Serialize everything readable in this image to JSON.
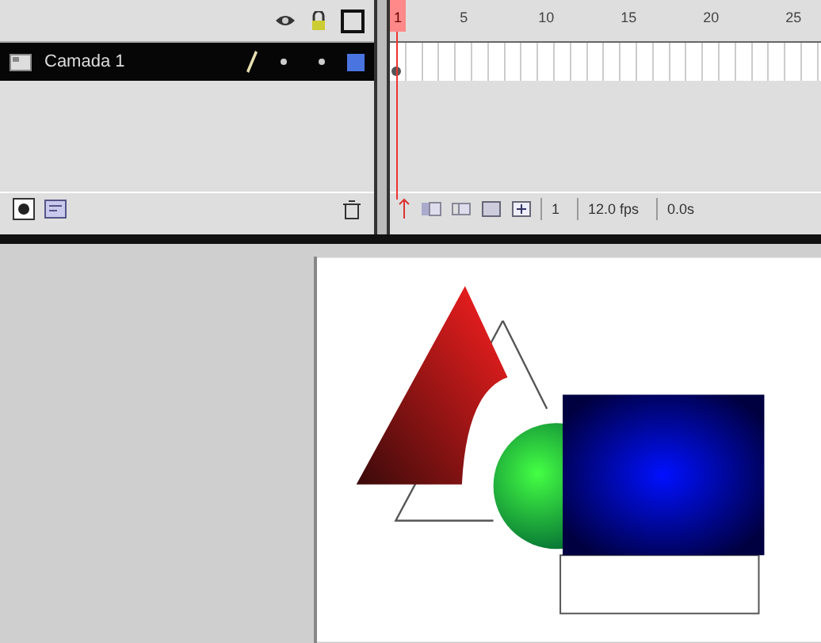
{
  "frame_ruler": [
    {
      "label": "1",
      "selected": true
    },
    {
      "label": "5",
      "selected": false
    },
    {
      "label": "10",
      "selected": false
    },
    {
      "label": "15",
      "selected": false
    },
    {
      "label": "20",
      "selected": false
    },
    {
      "label": "25",
      "selected": false
    }
  ],
  "layers": [
    {
      "name": "Camada 1",
      "selected": true,
      "visible": true,
      "locked": false,
      "color": "#4a74e0"
    }
  ],
  "status": {
    "current_frame": "1",
    "frame_rate": "12.0 fps",
    "elapsed_time": "0.0s"
  }
}
